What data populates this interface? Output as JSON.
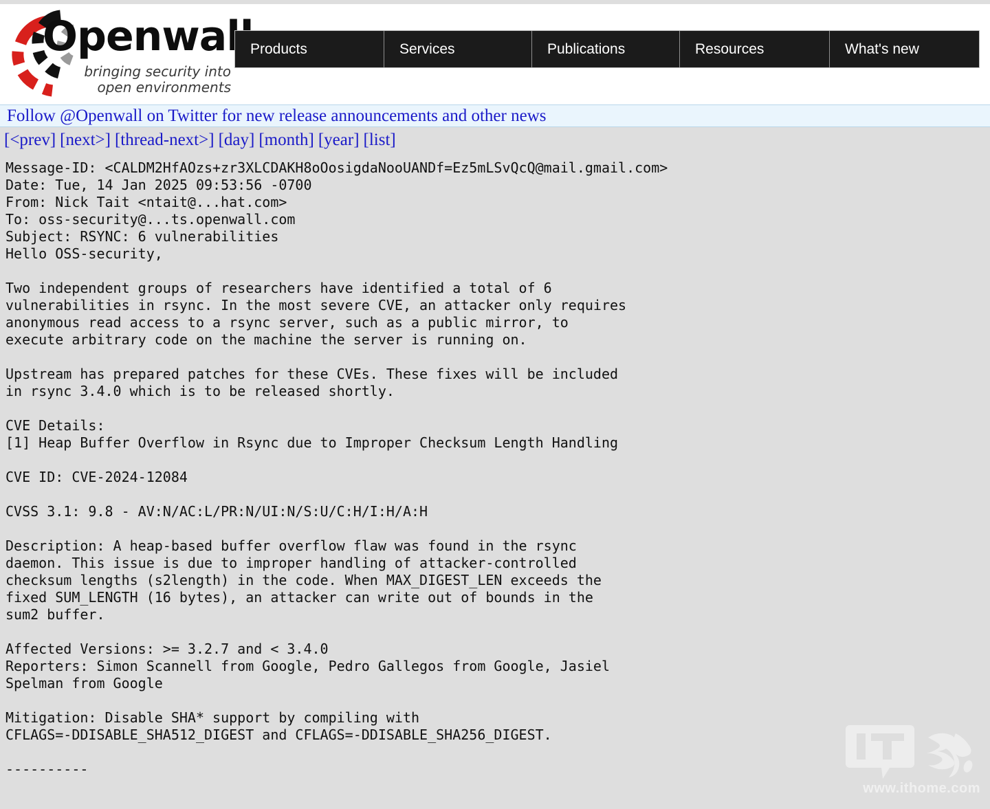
{
  "site": {
    "logo_word": "Openwall",
    "logo_tagline_line1": "bringing security into",
    "logo_tagline_line2": "open environments"
  },
  "nav": {
    "items": [
      {
        "label": "Products"
      },
      {
        "label": "Services"
      },
      {
        "label": "Publications"
      },
      {
        "label": "Resources"
      },
      {
        "label": "What's new"
      }
    ]
  },
  "banner": {
    "text": "Follow @Openwall on Twitter for new release announcements and other news"
  },
  "thread_nav": {
    "items": [
      {
        "label": "[<prev]"
      },
      {
        "label": "[next>]"
      },
      {
        "label": "[thread-next>]"
      },
      {
        "label": "[day]"
      },
      {
        "label": "[month]"
      },
      {
        "label": "[year]"
      },
      {
        "label": "[list]"
      }
    ]
  },
  "message": {
    "headers": {
      "message_id": "Message-ID: <CALDM2HfAOzs+zr3XLCDAKH8oOosigdaNooUANDf=Ez5mLSvQcQ@mail.gmail.com>",
      "date": "Date: Tue, 14 Jan 2025 09:53:56 -0700",
      "from": "From: Nick Tait <ntait@...hat.com>",
      "to": "To: oss-security@...ts.openwall.com",
      "subject": "Subject: RSYNC: 6 vulnerabilities"
    },
    "body": "Hello OSS-security,\n\nTwo independent groups of researchers have identified a total of 6\nvulnerabilities in rsync. In the most severe CVE, an attacker only requires\nanonymous read access to a rsync server, such as a public mirror, to\nexecute arbitrary code on the machine the server is running on.\n\nUpstream has prepared patches for these CVEs. These fixes will be included\nin rsync 3.4.0 which is to be released shortly.\n\nCVE Details:\n[1] Heap Buffer Overflow in Rsync due to Improper Checksum Length Handling\n\nCVE ID: CVE-2024-12084\n\nCVSS 3.1: 9.8 - AV:N/AC:L/PR:N/UI:N/S:U/C:H/I:H/A:H\n\nDescription: A heap-based buffer overflow flaw was found in the rsync\ndaemon. This issue is due to improper handling of attacker-controlled\nchecksum lengths (s2length) in the code. When MAX_DIGEST_LEN exceeds the\nfixed SUM_LENGTH (16 bytes), an attacker can write out of bounds in the\nsum2 buffer.\n\nAffected Versions: >= 3.2.7 and < 3.4.0\nReporters: Simon Scannell from Google, Pedro Gallegos from Google, Jasiel\nSpelman from Google\n\nMitigation: Disable SHA* support by compiling with\nCFLAGS=-DDISABLE_SHA512_DIGEST and CFLAGS=-DDISABLE_SHA256_DIGEST.\n\n----------"
  },
  "watermark": {
    "url": "www.ithome.com",
    "logo_text": "IT"
  },
  "colors": {
    "page_background": "#dedede",
    "header_background": "#ffffff",
    "nav_background": "#1b1b1b",
    "link_blue": "#1a1ac8",
    "banner_background": "#eaf5fd",
    "logo_red": "#d8201c",
    "logo_black": "#111111",
    "logo_gray": "#9a9a9a"
  }
}
